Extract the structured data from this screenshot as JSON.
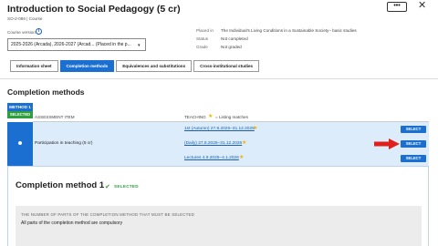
{
  "course": {
    "title": "Introduction to Social Pedagogy (5 cr)",
    "code": "SO-2-086 | Course"
  },
  "header_buttons": {
    "more": "•••",
    "close": "✕"
  },
  "curriculum": {
    "label": "Course version",
    "info_icon": "i",
    "selected": "2025-2026 (Arcada), 2026-2027 (Arcad... (Placed in the p...",
    "arrow": "▾"
  },
  "meta": {
    "placed_key": "Placed in",
    "placed_value": "The Individual's Living Conditions in a Sustainable Society– basic studies",
    "status_key": "Status",
    "status_value": "Not completed",
    "grade_key": "Grade",
    "grade_value": "Not graded"
  },
  "tabs": [
    {
      "label": "Information sheet",
      "active": false
    },
    {
      "label": "Completion methods",
      "active": true
    },
    {
      "label": "Equivalences and substitutions",
      "active": false
    },
    {
      "label": "Cross-institutional studies",
      "active": false
    }
  ],
  "completion": {
    "section_title": "Completion methods",
    "method_badge": "METHOD 1",
    "selected_badge": "SELECTED",
    "col_assessment": "ASSESSMENT ITEM",
    "col_teaching": "TEACHING",
    "legend_star": "★",
    "legend_text": "= Listing matches",
    "item_name": "Participation in teaching (5 cr)",
    "teaching": [
      {
        "label": "1st (Autumn) 27.8.2025–31.12.2025",
        "star": "★",
        "button": "SELECT"
      },
      {
        "label": "(Daily) 27.8.2025–31.12.2026",
        "star": "★",
        "button": "SELECT"
      },
      {
        "label": "Lectures 4.9.2025–4.1.2026",
        "star": "★",
        "button": "SELECT"
      }
    ]
  },
  "detail": {
    "title": "Completion method 1",
    "check": "✔",
    "selected": "SELECTED",
    "parts_label": "THE NUMBER OF PARTS OF THE COMPLETION METHOD THAT MUST BE SELECTED",
    "parts_value": "All parts of the completion method are compulsory"
  },
  "colors": {
    "primary": "#1a6fd0",
    "selected_green": "#2e9e3f",
    "row_highlight": "#dcecfb",
    "annotation_red": "#e0201b",
    "star": "#f4b400"
  }
}
